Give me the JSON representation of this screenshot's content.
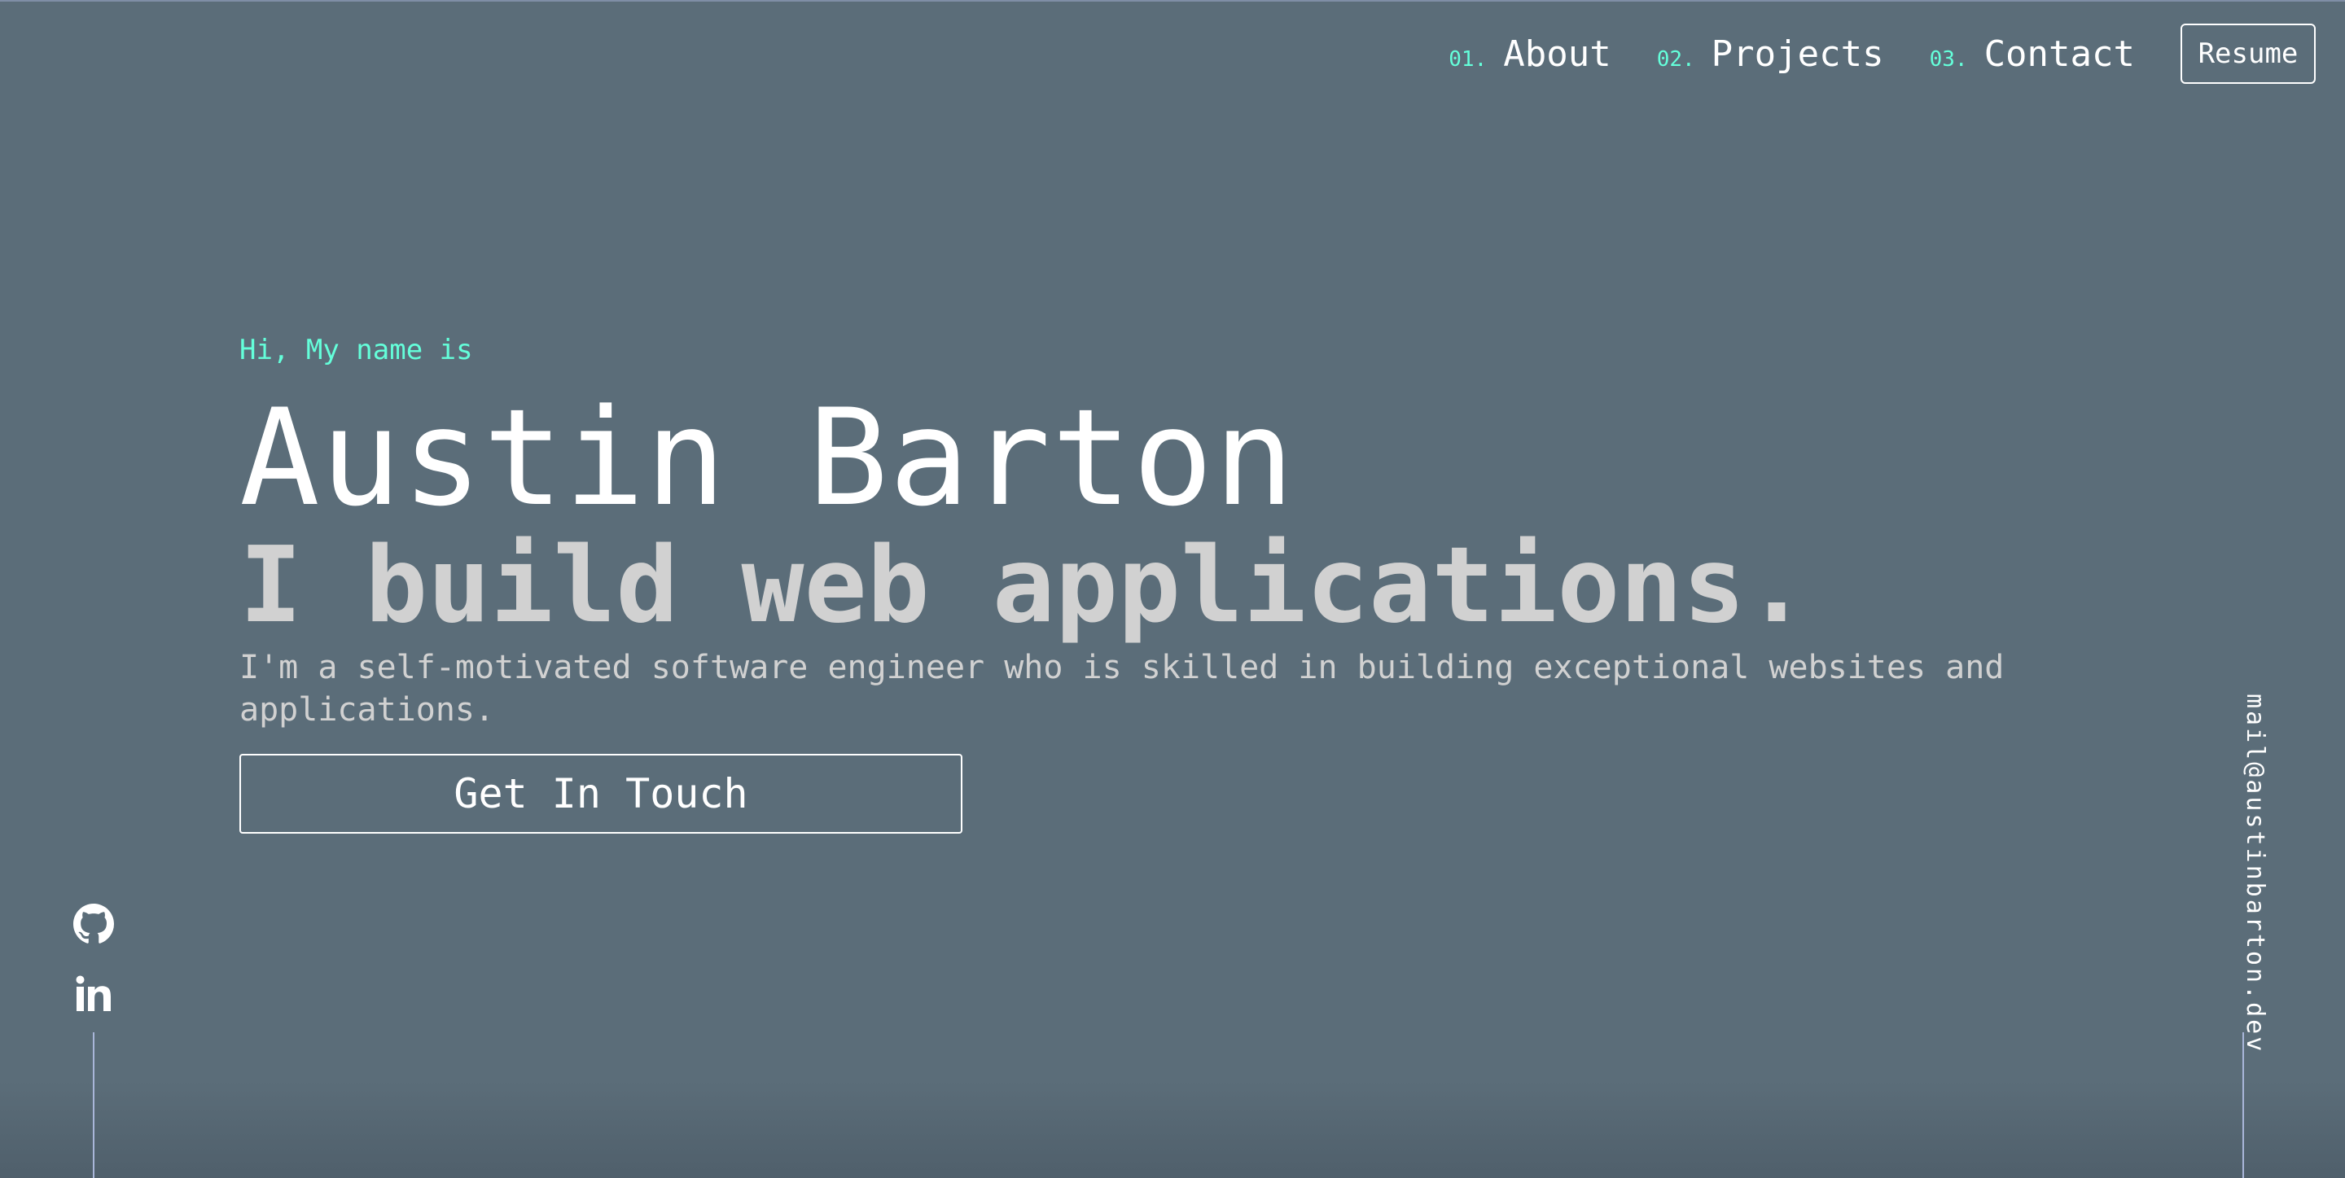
{
  "nav": {
    "items": [
      {
        "num": "01.",
        "label": "About"
      },
      {
        "num": "02.",
        "label": "Projects"
      },
      {
        "num": "03.",
        "label": "Contact"
      }
    ],
    "resume_label": "Resume"
  },
  "hero": {
    "greeting": "Hi, My name is",
    "name": "Austin Barton",
    "tagline": "I build web applications.",
    "description": "I'm a self-motivated software engineer who is skilled in building exceptional websites and applications.",
    "cta_label": "Get In Touch"
  },
  "socials": {
    "icons": [
      "github-icon",
      "linkedin-icon"
    ]
  },
  "email": "mail@austinbarton.dev",
  "colors": {
    "background": "#5b6d79",
    "accent": "#64ffda",
    "text": "#ffffff",
    "muted_text": "#d1d1d1",
    "rule": "#a9b6d9"
  }
}
